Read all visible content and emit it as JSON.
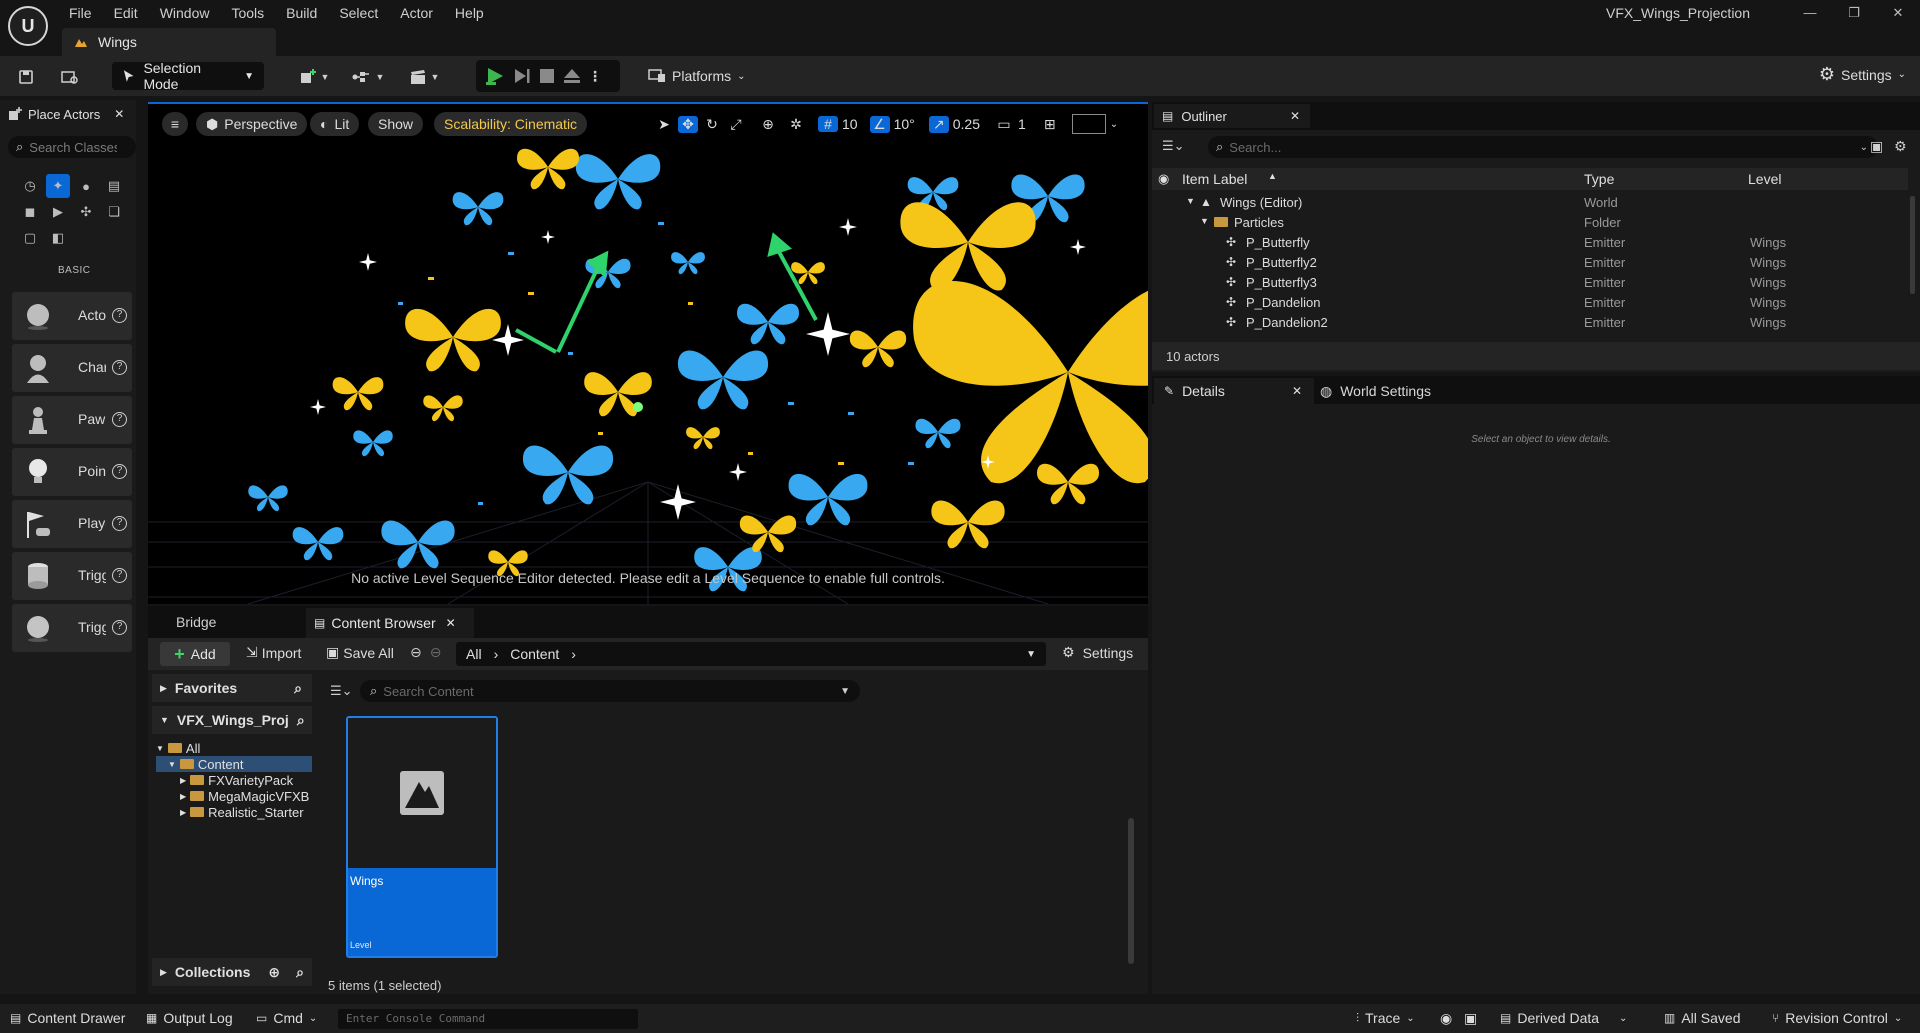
{
  "app": {
    "menus": [
      "File",
      "Edit",
      "Window",
      "Tools",
      "Build",
      "Select",
      "Actor",
      "Help"
    ],
    "project_title": "VFX_Wings_Projection",
    "document_tab": "Wings"
  },
  "toolbar": {
    "selection_mode": "Selection Mode",
    "platforms": "Platforms",
    "settings": "Settings"
  },
  "place_actors": {
    "tab_label": "Place Actors",
    "search_placeholder": "Search Classes",
    "category_label": "BASIC",
    "items": [
      "Actor",
      "Character",
      "Pawn",
      "Point Light",
      "Player Start",
      "Trigger Box",
      "Trigger Sphere"
    ]
  },
  "viewport": {
    "perspective": "Perspective",
    "lit": "Lit",
    "show": "Show",
    "scalability": "Scalability: Cinematic",
    "grid_snap": "10",
    "rotation_snap": "10°",
    "scale_snap": "0.25",
    "camera_speed": "1",
    "notice": "No active Level Sequence Editor detected. Please edit a Level Sequence to enable full controls."
  },
  "content_browser": {
    "tab_bridge": "Bridge",
    "tab_label": "Content Browser",
    "add": "Add",
    "import": "Import",
    "save_all": "Save All",
    "path": [
      "All",
      "Content"
    ],
    "settings": "Settings",
    "favorites": "Favorites",
    "project": "VFX_Wings_Proj",
    "tree": [
      "All",
      "Content",
      "FXVarietyPack",
      "MegaMagicVFXB",
      "Realistic_Starter"
    ],
    "search_placeholder": "Search Content",
    "asset": {
      "name": "Wings",
      "type": "Level"
    },
    "collections": "Collections",
    "count": "5 items (1 selected)"
  },
  "outliner": {
    "tab_label": "Outliner",
    "search_placeholder": "Search...",
    "columns": [
      "Item Label",
      "Type",
      "Level"
    ],
    "rows": [
      {
        "label": "Wings (Editor)",
        "type": "World",
        "level": "",
        "indent": 1
      },
      {
        "label": "Particles",
        "type": "Folder",
        "level": "",
        "indent": 2
      },
      {
        "label": "P_Butterfly",
        "type": "Emitter",
        "level": "Wings",
        "indent": 3
      },
      {
        "label": "P_Butterfly2",
        "type": "Emitter",
        "level": "Wings",
        "indent": 3
      },
      {
        "label": "P_Butterfly3",
        "type": "Emitter",
        "level": "Wings",
        "indent": 3
      },
      {
        "label": "P_Dandelion",
        "type": "Emitter",
        "level": "Wings",
        "indent": 3
      },
      {
        "label": "P_Dandelion2",
        "type": "Emitter",
        "level": "Wings",
        "indent": 3
      }
    ],
    "footer": "10 actors"
  },
  "details": {
    "tab_label": "Details",
    "world_settings": "World Settings",
    "hint": "Select an object to view details."
  },
  "statusbar": {
    "content_drawer": "Content Drawer",
    "output_log": "Output Log",
    "cmd": "Cmd",
    "console_placeholder": "Enter Console Command",
    "trace": "Trace",
    "derived_data": "Derived Data",
    "all_saved": "All Saved",
    "revision_control": "Revision Control"
  }
}
